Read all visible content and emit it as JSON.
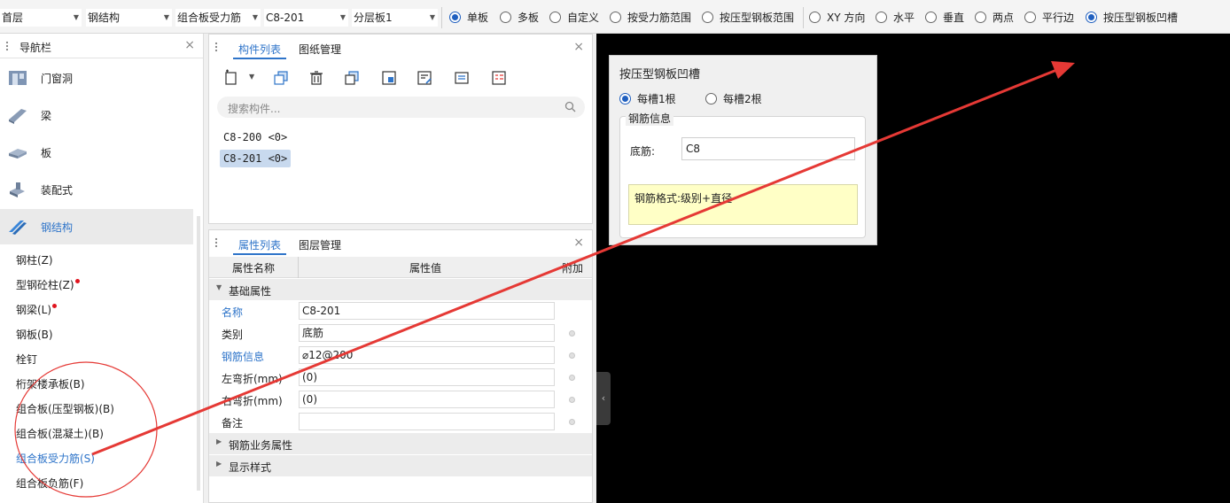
{
  "toolbar": {
    "floor": "首层",
    "category": "钢结构",
    "component_type": "组合板受力筋",
    "component": "C8-201",
    "layer": "分层板1",
    "scope_options": [
      {
        "label": "单板",
        "checked": true
      },
      {
        "label": "多板",
        "checked": false
      },
      {
        "label": "自定义",
        "checked": false
      },
      {
        "label": "按受力筋范围",
        "checked": false
      },
      {
        "label": "按压型钢板范围",
        "checked": false
      }
    ],
    "direction_options": [
      {
        "label": "XY 方向",
        "checked": false
      },
      {
        "label": "水平",
        "checked": false
      },
      {
        "label": "垂直",
        "checked": false
      },
      {
        "label": "两点",
        "checked": false
      },
      {
        "label": "平行边",
        "checked": false
      },
      {
        "label": "按压型钢板凹槽",
        "checked": true
      }
    ]
  },
  "nav": {
    "title": "导航栏",
    "close": "×",
    "categories": [
      {
        "label": "门窗洞",
        "icon": "door-window-icon"
      },
      {
        "label": "梁",
        "icon": "beam-icon"
      },
      {
        "label": "板",
        "icon": "slab-icon"
      },
      {
        "label": "装配式",
        "icon": "prefab-icon"
      },
      {
        "label": "钢结构",
        "icon": "steel-structure-icon",
        "selected": true
      }
    ],
    "items": [
      {
        "label": "钢柱(Z)"
      },
      {
        "label": "型钢砼柱(Z)",
        "dot": true
      },
      {
        "label": "钢梁(L)",
        "dot": true
      },
      {
        "label": "钢板(B)"
      },
      {
        "label": "栓钉"
      },
      {
        "label": "桁架楼承板(B)"
      },
      {
        "label": "组合板(压型钢板)(B)"
      },
      {
        "label": "组合板(混凝土)(B)"
      },
      {
        "label": "组合板受力筋(S)",
        "selected": true
      },
      {
        "label": "组合板负筋(F)"
      }
    ]
  },
  "component_panel": {
    "tabs": [
      "构件列表",
      "图纸管理"
    ],
    "close": "×",
    "search_placeholder": "搜索构件...",
    "components": [
      {
        "label": "C8-200 <0>",
        "selected": false
      },
      {
        "label": "C8-201 <0>",
        "selected": true
      }
    ]
  },
  "property_panel": {
    "tabs": [
      "属性列表",
      "图层管理"
    ],
    "close": "×",
    "columns": [
      "属性名称",
      "属性值",
      "附加"
    ],
    "group_basic": "基础属性",
    "rows": [
      {
        "name": "名称",
        "value": "C8-201",
        "blue": true,
        "dot": false
      },
      {
        "name": "类别",
        "value": "底筋",
        "blue": false,
        "dot": true
      },
      {
        "name": "钢筋信息",
        "value": "⌀12@200",
        "blue": true,
        "dot": true
      },
      {
        "name": "左弯折(mm)",
        "value": "(0)",
        "blue": false,
        "dot": true
      },
      {
        "name": "右弯折(mm)",
        "value": "(0)",
        "blue": false,
        "dot": true
      },
      {
        "name": "备注",
        "value": "",
        "blue": false,
        "dot": true
      }
    ],
    "group_rebar": "钢筋业务属性",
    "group_display": "显示样式"
  },
  "dialog": {
    "title": "按压型钢板凹槽",
    "options": [
      {
        "label": "每槽1根",
        "checked": true
      },
      {
        "label": "每槽2根",
        "checked": false
      }
    ],
    "group_label": "钢筋信息",
    "field_label": "底筋:",
    "field_value": "C8",
    "hint": "钢筋格式:级别+直径"
  },
  "colors": {
    "accent": "#2e74c9",
    "annotation": "#e53935",
    "viewport": "#000000",
    "hint_bg": "#ffffc6"
  }
}
